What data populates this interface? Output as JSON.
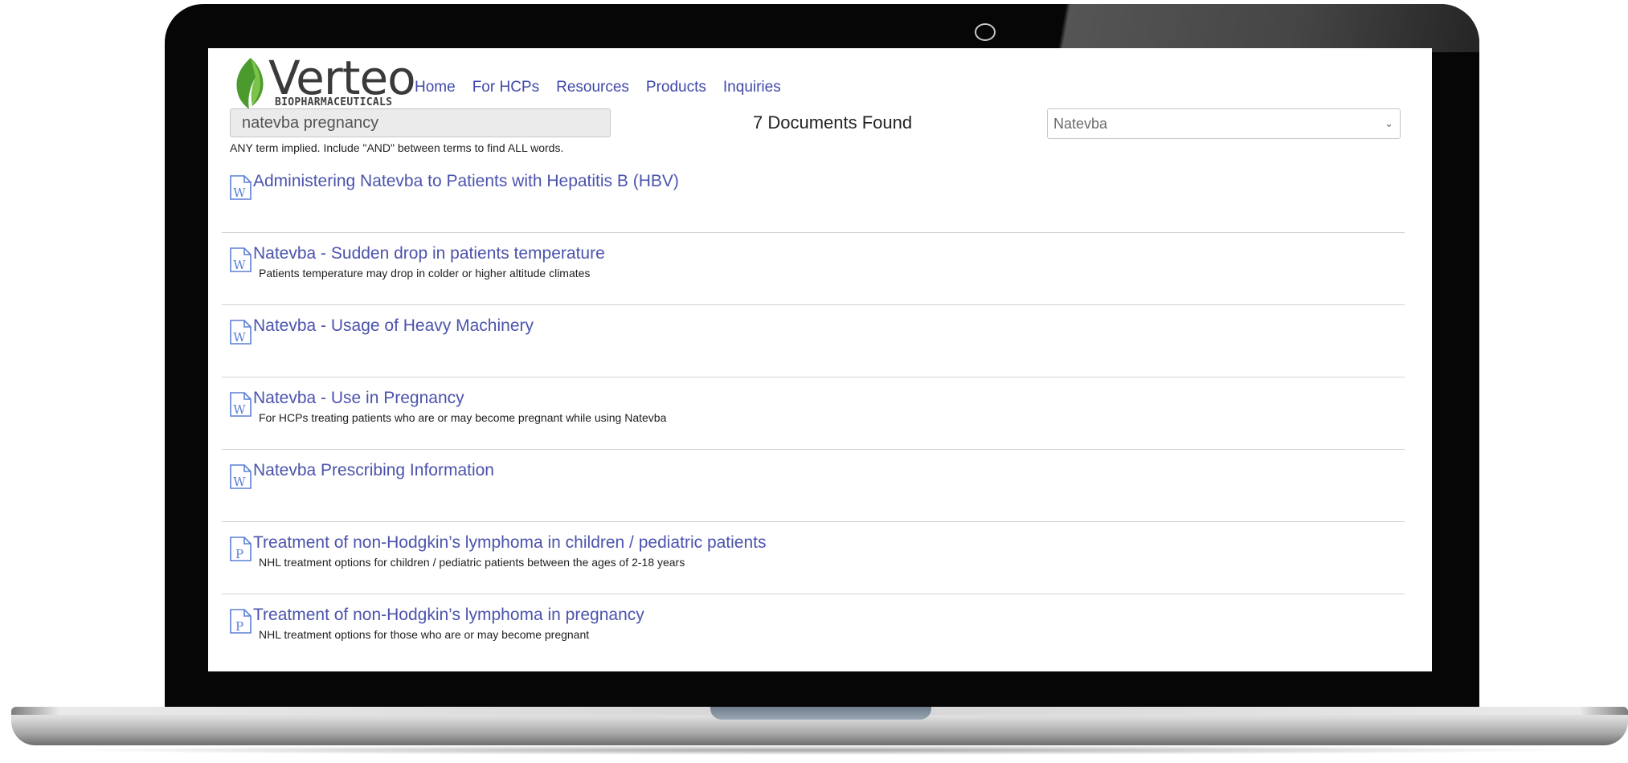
{
  "brand": {
    "name": "Verteo",
    "subtitle": "BIOPHARMACEUTICALS",
    "leaf_color": "#4a9a2e"
  },
  "nav": {
    "items": [
      {
        "label": "Home"
      },
      {
        "label": "For HCPs"
      },
      {
        "label": "Resources"
      },
      {
        "label": "Products"
      },
      {
        "label": "Inquiries"
      }
    ]
  },
  "search": {
    "value": "natevba pregnancy",
    "hint": "ANY term implied. Include \"AND\" between terms to find ALL words.",
    "results_count": "7 Documents Found",
    "product_filter": "Natevba"
  },
  "results": [
    {
      "type": "W",
      "icon": "word-doc-icon",
      "title": "Administering Natevba to Patients with Hepatitis B (HBV)",
      "description": ""
    },
    {
      "type": "W",
      "icon": "word-doc-icon",
      "title": "Natevba - Sudden drop in patients temperature",
      "description": "Patients temperature may drop in colder or higher altitude climates"
    },
    {
      "type": "W",
      "icon": "word-doc-icon",
      "title": "Natevba - Usage of Heavy Machinery",
      "description": ""
    },
    {
      "type": "W",
      "icon": "word-doc-icon",
      "title": "Natevba - Use in Pregnancy",
      "description": "For HCPs treating patients who are or may become pregnant while using Natevba"
    },
    {
      "type": "W",
      "icon": "word-doc-icon",
      "title": "Natevba Prescribing Information",
      "description": ""
    },
    {
      "type": "P",
      "icon": "pdf-doc-icon",
      "title": "Treatment of non-Hodgkin’s lymphoma in children / pediatric patients",
      "description": "NHL treatment options for children / pediatric patients between the ages of 2-18 years"
    },
    {
      "type": "P",
      "icon": "pdf-doc-icon",
      "title": "Treatment of non-Hodgkin’s lymphoma in pregnancy",
      "description": "NHL treatment options for those who are or may become pregnant"
    }
  ],
  "colors": {
    "link": "#4b53ad",
    "icon": "#5b7fd6",
    "bezel": "#060606"
  }
}
